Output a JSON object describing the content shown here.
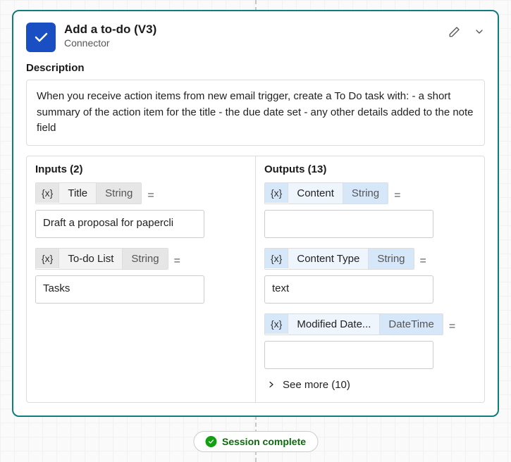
{
  "header": {
    "title": "Add a to-do (V3)",
    "subtitle": "Connector"
  },
  "description": {
    "label": "Description",
    "text": "When you receive action items from new email trigger, create a To Do task with: - a short summary of the action item for the title - the due date set - any other details added to the note field"
  },
  "inputs": {
    "heading": "Inputs (2)",
    "params": [
      {
        "var": "{x}",
        "name": "Title",
        "type": "String",
        "eq": "=",
        "value": "Draft a proposal for papercli"
      },
      {
        "var": "{x}",
        "name": "To-do List",
        "type": "String",
        "eq": "=",
        "value": "Tasks"
      }
    ]
  },
  "outputs": {
    "heading": "Outputs (13)",
    "params": [
      {
        "var": "{x}",
        "name": "Content",
        "type": "String",
        "eq": "=",
        "value": ""
      },
      {
        "var": "{x}",
        "name": "Content Type",
        "type": "String",
        "eq": "=",
        "value": "text"
      },
      {
        "var": "{x}",
        "name": "Modified Date...",
        "type": "DateTime",
        "eq": "=",
        "value": ""
      }
    ],
    "see_more": "See more (10)"
  },
  "status": {
    "label": "Session complete"
  }
}
